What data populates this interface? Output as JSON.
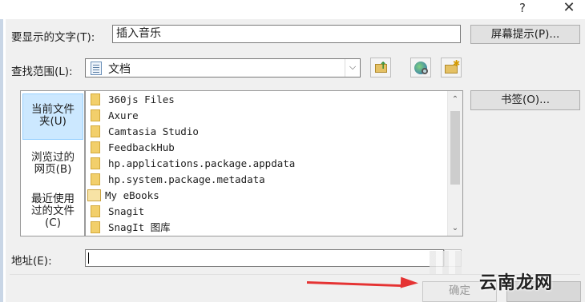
{
  "titlebar": {
    "help_label": "?",
    "close_label": "✕"
  },
  "display_text": {
    "label": "要显示的文字(T):",
    "value": "插入音乐"
  },
  "screentip_button": "屏幕提示(P)...",
  "look_in": {
    "label": "查找范围(L):",
    "value": "文档",
    "dropdown_icon": "chevron-down-icon"
  },
  "toolbar": {
    "up_icon": "folder-up-icon",
    "web_icon": "browse-web-icon",
    "new_folder_icon": "new-folder-icon"
  },
  "bookmark_button": "书签(O)...",
  "places": [
    {
      "line1": "当前文件",
      "line2": "夹(U)",
      "selected": true
    },
    {
      "line1": "浏览过的",
      "line2": "网页(B)",
      "selected": false
    },
    {
      "line1": "最近使用",
      "line2": "过的文件",
      "line3": "(C)",
      "selected": false
    }
  ],
  "files": [
    {
      "name": "360js Files",
      "icon": "folder-icon"
    },
    {
      "name": "Axure",
      "icon": "folder-icon"
    },
    {
      "name": "Camtasia Studio",
      "icon": "folder-icon"
    },
    {
      "name": "FeedbackHub",
      "icon": "folder-icon"
    },
    {
      "name": "hp.applications.package.appdata",
      "icon": "folder-icon"
    },
    {
      "name": "hp.system.package.metadata",
      "icon": "folder-icon"
    },
    {
      "name": "My eBooks",
      "icon": "open-folder-icon"
    },
    {
      "name": "Snagit",
      "icon": "folder-icon"
    },
    {
      "name": "SnagIt 图库",
      "icon": "folder-icon"
    }
  ],
  "address": {
    "label": "地址(E):",
    "value": ""
  },
  "ok_button": "确定",
  "cancel_button": "",
  "watermark": "云南龙网",
  "colors": {
    "annotation_arrow": "#e53333",
    "selection": "#cce8ff"
  }
}
